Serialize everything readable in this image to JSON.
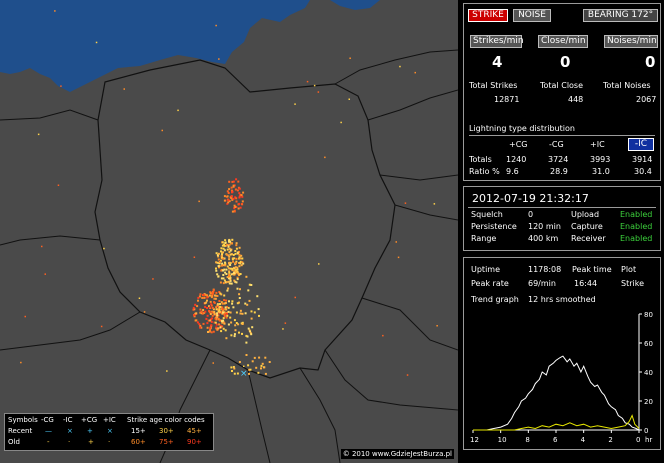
{
  "map": {
    "copyright": "© 2010 www.GdzieJestBurza.pl",
    "land_color": "#4a4a4a",
    "sea_color": "#1f4f8c"
  },
  "legend": {
    "symbols_label": "Symbols",
    "col_cg_neg": "-CG",
    "col_ic_neg": "-IC",
    "col_cg_pos": "+CG",
    "col_ic_pos": "+IC",
    "recent_label": "Recent",
    "old_label": "Old",
    "recent_cg_neg": "—",
    "recent_ic_neg": "×",
    "recent_cg_pos": "+",
    "recent_ic_pos": "×",
    "old_cg_neg": "-",
    "old_ic_neg": "·",
    "old_cg_pos": "+",
    "old_ic_pos": "·",
    "age_title": "Strike age color codes",
    "age_1": "15+",
    "age_2": "30+",
    "age_3": "45+",
    "age_4": "60+",
    "age_5": "75+",
    "age_6": "90+"
  },
  "panel": {
    "strike_btn": "STRIKE",
    "noise_btn": "NOISE",
    "bearing_btn": "BEARING 172°",
    "strikes_min_btn": "Strikes/min",
    "close_min_btn": "Close/min",
    "noises_min_btn": "Noises/min",
    "strikes_min": "4",
    "close_min": "0",
    "noises_min": "0",
    "total_strikes_label": "Total Strikes",
    "total_close_label": "Total Close",
    "total_noises_label": "Total Noises",
    "total_strikes": "12871",
    "total_close": "448",
    "total_noises": "2067",
    "dist_title": "Lightning type distribution",
    "dist_cols": [
      "+CG",
      "-CG",
      "+IC",
      "-IC"
    ],
    "totals_label": "Totals",
    "totals": [
      "1240",
      "3724",
      "3993",
      "3914"
    ],
    "ratio_label": "Ratio %",
    "ratios": [
      "9.6",
      "28.9",
      "31.0",
      "30.4"
    ],
    "datetime": "2012-07-19 21:32:17",
    "squelch_label": "Squelch",
    "squelch_value": "0",
    "upload_label": "Upload",
    "upload_value": "Enabled",
    "persistence_label": "Persistence",
    "persistence_value": "120 min",
    "capture_label": "Capture",
    "capture_value": "Enabled",
    "range_label": "Range",
    "range_value": "400 km",
    "receiver_label": "Receiver",
    "receiver_value": "Enabled",
    "uptime_label": "Uptime",
    "uptime_value": "1178:08",
    "peak_time_label": "Peak time",
    "plot_label": "Plot",
    "peak_rate_label": "Peak rate",
    "peak_rate_value": "69/min",
    "peak_time_value": "16:44",
    "strike_label": "Strike",
    "trend_label": "Trend graph",
    "trend_value": "12 hrs smoothed"
  },
  "chart_data": {
    "type": "line",
    "title": "",
    "xlabel": "hr",
    "ylabel": "",
    "x_ticks": [
      "12",
      "10",
      "8",
      "6",
      "4",
      "2",
      "0"
    ],
    "y_ticks": [
      "80",
      "60",
      "40",
      "20",
      "0"
    ],
    "xlim": [
      12,
      0
    ],
    "ylim": [
      0,
      80
    ],
    "series": [
      {
        "color": "#ffffff",
        "x": [
          12,
          11.5,
          11,
          10.5,
          10,
          9.5,
          9.2,
          9,
          8.7,
          8.5,
          8.2,
          8,
          7.7,
          7.5,
          7.2,
          7,
          6.7,
          6.5,
          6.2,
          6,
          5.7,
          5.5,
          5.2,
          5,
          4.7,
          4.5,
          4.2,
          4,
          3.7,
          3.5,
          3.2,
          3,
          2.7,
          2.5,
          2.2,
          2,
          1.7,
          1.5,
          1.2,
          1,
          0.7,
          0.5,
          0.2,
          0
        ],
        "y": [
          0,
          0,
          0,
          1,
          2,
          4,
          8,
          12,
          16,
          20,
          22,
          25,
          28,
          32,
          35,
          40,
          38,
          44,
          46,
          48,
          50,
          51,
          47,
          49,
          44,
          46,
          40,
          44,
          37,
          33,
          30,
          31,
          26,
          24,
          18,
          16,
          14,
          10,
          8,
          5,
          4,
          2,
          1,
          0
        ]
      },
      {
        "color": "#e6e600",
        "x": [
          12,
          10,
          9,
          8.5,
          8,
          7.5,
          7,
          6.5,
          6,
          5.5,
          5,
          4.5,
          4,
          3.5,
          3,
          2.5,
          2,
          1.5,
          1,
          0.7,
          0.5,
          0.3,
          0
        ],
        "y": [
          0,
          0,
          0,
          1,
          2,
          1,
          3,
          2,
          4,
          3,
          5,
          3,
          4,
          2,
          3,
          2,
          1,
          2,
          3,
          6,
          10,
          4,
          1
        ]
      }
    ]
  }
}
